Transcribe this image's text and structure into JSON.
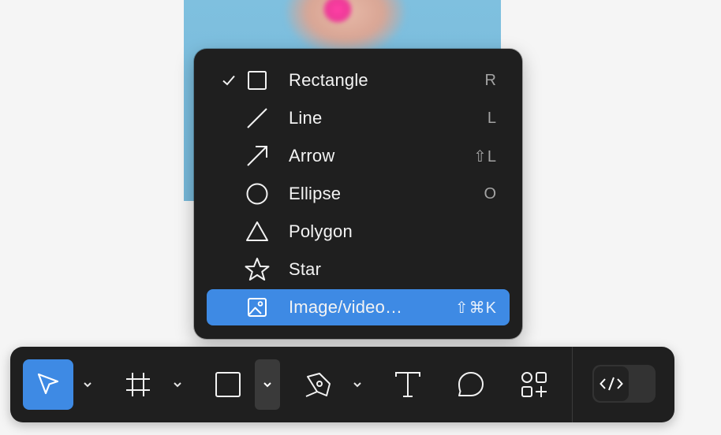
{
  "menu": {
    "items": [
      {
        "label": "Rectangle",
        "shortcut": "R",
        "checked": true,
        "icon": "rectangle-icon"
      },
      {
        "label": "Line",
        "shortcut": "L",
        "checked": false,
        "icon": "line-icon"
      },
      {
        "label": "Arrow",
        "shortcut": "⇧L",
        "checked": false,
        "icon": "arrow-icon"
      },
      {
        "label": "Ellipse",
        "shortcut": "O",
        "checked": false,
        "icon": "ellipse-icon"
      },
      {
        "label": "Polygon",
        "shortcut": "",
        "checked": false,
        "icon": "polygon-icon"
      },
      {
        "label": "Star",
        "shortcut": "",
        "checked": false,
        "icon": "star-icon"
      },
      {
        "label": "Image/video…",
        "shortcut": "⇧⌘K",
        "checked": false,
        "highlighted": true,
        "icon": "image-icon"
      }
    ]
  },
  "toolbar": {
    "tools": [
      "move-tool",
      "frame-tool",
      "shape-tool",
      "pen-tool",
      "text-tool",
      "comment-tool",
      "actions-tool"
    ],
    "active_tool": "move-tool",
    "open_menu": "shape-tool"
  },
  "colors": {
    "accent": "#3e8ae4",
    "menu_bg": "#1f1f1f",
    "toolbar_bg": "#1f1f1f"
  }
}
